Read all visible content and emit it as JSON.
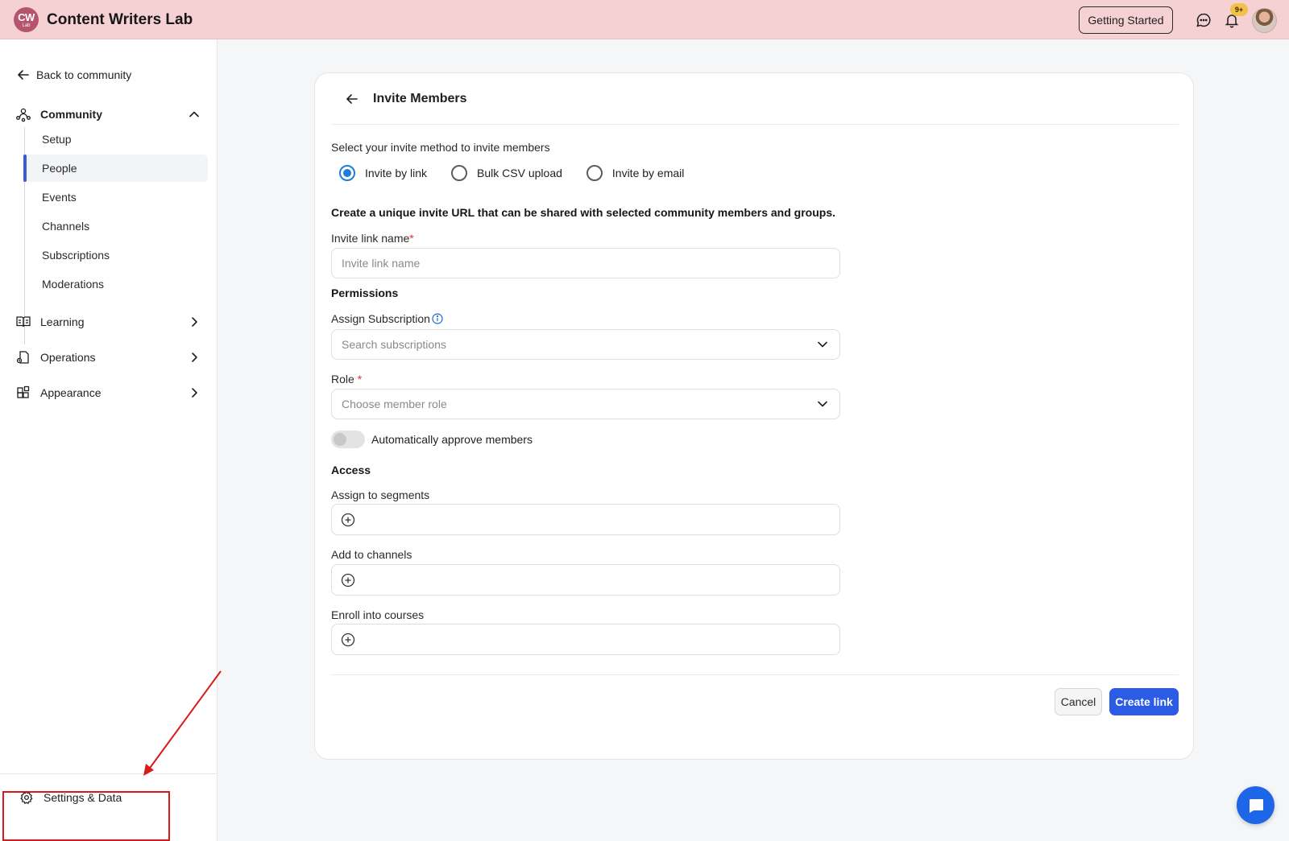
{
  "app": {
    "logo_line1": "CW",
    "logo_line2": "Lab",
    "name": "Content Writers Lab",
    "brand_color": "#b5546f",
    "topbar_color": "#f6d1d4"
  },
  "topbar": {
    "getting_started_label": "Getting Started",
    "notification_badge": "9+",
    "icons": [
      "chat-bubble-icon",
      "bell-icon"
    ]
  },
  "sidebar": {
    "back_label": "Back to community",
    "community_label": "Community",
    "community_items": [
      {
        "label": "Setup"
      },
      {
        "label": "People",
        "active": true
      },
      {
        "label": "Events"
      },
      {
        "label": "Channels"
      },
      {
        "label": "Subscriptions"
      },
      {
        "label": "Moderations"
      }
    ],
    "sections": [
      {
        "label": "Learning",
        "icon": "book-icon"
      },
      {
        "label": "Operations",
        "icon": "operations-icon"
      },
      {
        "label": "Appearance",
        "icon": "appearance-icon"
      }
    ],
    "settings_label": "Settings & Data"
  },
  "invite": {
    "title": "Invite Members",
    "method_prompt": "Select your invite method to invite members",
    "methods": [
      {
        "label": "Invite by link",
        "selected": true
      },
      {
        "label": "Bulk CSV upload",
        "selected": false
      },
      {
        "label": "Invite by email",
        "selected": false
      }
    ],
    "description": "Create a unique invite URL that can be shared with selected community members and groups.",
    "link_name_label": "Invite link name",
    "link_name_placeholder": "Invite link name",
    "link_name_value": "",
    "permissions_heading": "Permissions",
    "subscription_label": "Assign Subscription",
    "subscription_placeholder": "Search subscriptions",
    "role_label": "Role",
    "role_placeholder": "Choose member role",
    "auto_approve_label": "Automatically approve members",
    "auto_approve_on": false,
    "access_heading": "Access",
    "segments_label": "Assign to segments",
    "channels_label": "Add to channels",
    "courses_label": "Enroll into courses",
    "required_marker": "*",
    "cancel_label": "Cancel",
    "create_label": "Create link",
    "accent_color": "#2c5be6"
  }
}
